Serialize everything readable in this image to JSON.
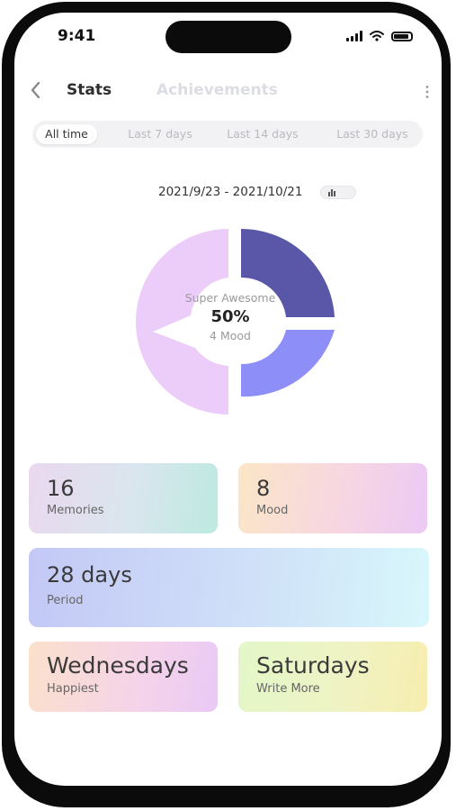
{
  "status_bar": {
    "time": "9:41"
  },
  "header": {
    "tabs": [
      {
        "label": "Stats",
        "active": true
      },
      {
        "label": "Achievements",
        "active": false
      }
    ]
  },
  "ranges": [
    {
      "label": "All time",
      "active": true
    },
    {
      "label": "Last 7 days",
      "active": false
    },
    {
      "label": "Last 14 days",
      "active": false
    },
    {
      "label": "Last 30 days",
      "active": false
    }
  ],
  "date_range": "2021/9/23 - 2021/10/21",
  "donut": {
    "label": "Super Awesome",
    "percent": "50%",
    "sublabel": "4 Mood",
    "segments": [
      {
        "share": 0.5,
        "color": "#ECCDF9"
      },
      {
        "share": 0.25,
        "color": "#5A57A8"
      },
      {
        "share": 0.25,
        "color": "#8E8EF8"
      }
    ]
  },
  "cards": [
    {
      "value": "16",
      "label": "Memories"
    },
    {
      "value": "8",
      "label": "Mood"
    },
    {
      "value": "28 days",
      "label": "Period"
    },
    {
      "value": "Wednesdays",
      "label": "Happiest"
    },
    {
      "value": "Saturdays",
      "label": "Write More"
    }
  ],
  "colors": {
    "active_text": "#2F2F2F",
    "inactive_tab": "#DCDCE4",
    "segment_light": "#ECCDF9",
    "segment_dark": "#5A57A8",
    "segment_mid": "#8E8EF8"
  }
}
